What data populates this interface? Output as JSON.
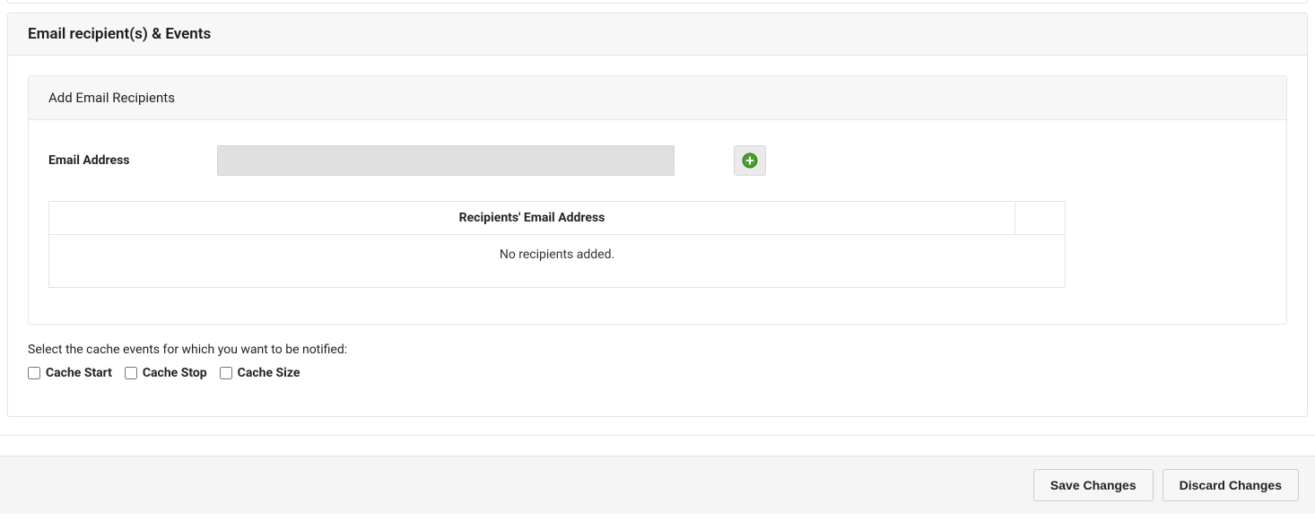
{
  "section": {
    "title": "Email recipient(s) & Events"
  },
  "recipients_panel": {
    "title": "Add Email Recipients",
    "email_label": "Email Address",
    "email_value": "",
    "table_header": "Recipients' Email Address",
    "empty_message": "No recipients added."
  },
  "events": {
    "helper": "Select the cache events for which you want to be notified:",
    "options": [
      {
        "label": "Cache Start",
        "checked": false
      },
      {
        "label": "Cache Stop",
        "checked": false
      },
      {
        "label": "Cache Size",
        "checked": false
      }
    ]
  },
  "footer": {
    "save_label": "Save Changes",
    "discard_label": "Discard Changes"
  }
}
